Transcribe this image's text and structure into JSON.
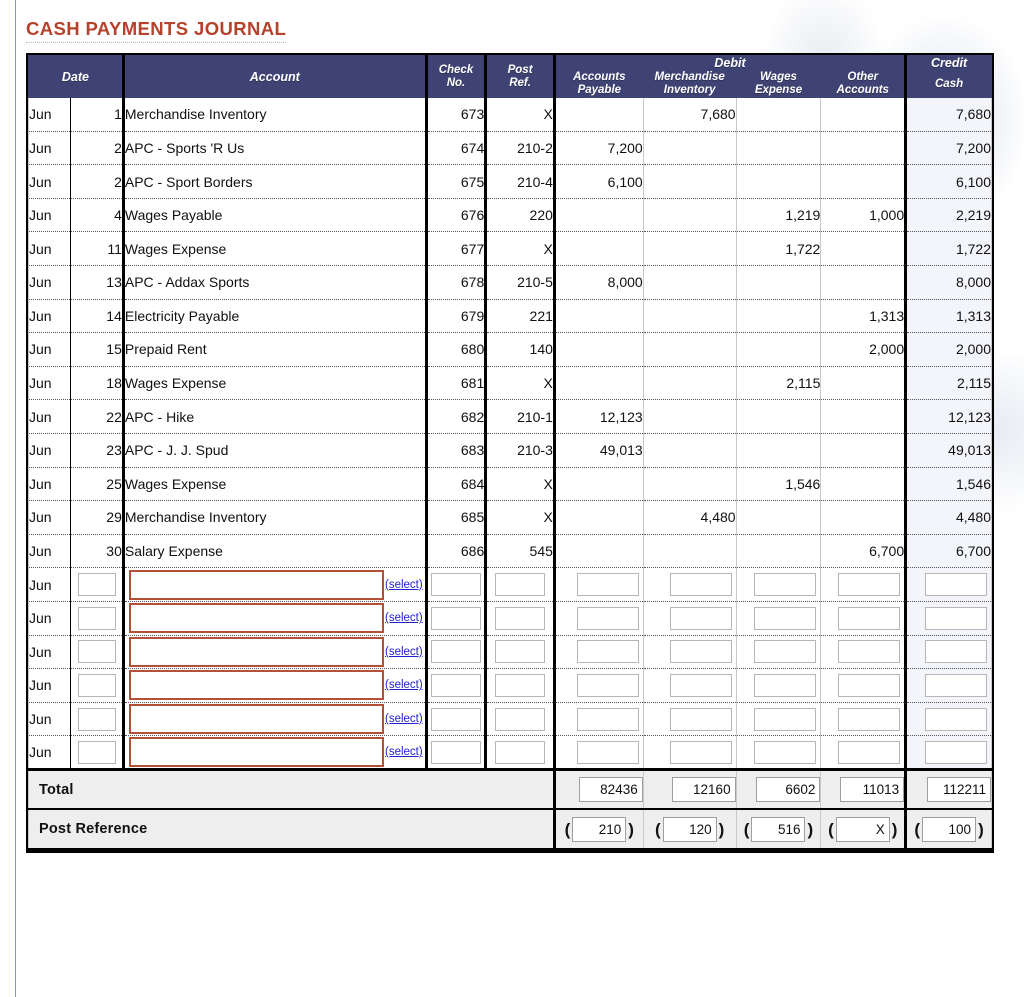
{
  "page": {
    "title": "CASH PAYMENTS JOURNAL",
    "title_color": "#b4422c",
    "header_bg": "#3e4373",
    "account_input_border": "#b4503a",
    "link_color": "#2222cc"
  },
  "table": {
    "headers": {
      "date": "Date",
      "account": "Account",
      "check_no": "Check No.",
      "check_no_l1": "Check",
      "check_no_l2": "No.",
      "post_ref": "Post Ref.",
      "post_ref_l1": "Post",
      "post_ref_l2": "Ref.",
      "debit_group": "Debit",
      "credit_group": "Credit",
      "accounts_payable_l1": "Accounts",
      "accounts_payable_l2": "Payable",
      "merchandise_inventory_l1": "Merchandise",
      "merchandise_inventory_l2": "Inventory",
      "wages_expense_l1": "Wages",
      "wages_expense_l2": "Expense",
      "other_accounts_l1": "Other",
      "other_accounts_l2": "Accounts",
      "cash": "Cash"
    },
    "rows": [
      {
        "month": "Jun",
        "day": "1",
        "account": "Merchandise Inventory",
        "check": "673",
        "ref": "X",
        "ap": "",
        "mi": "7,680",
        "we": "",
        "oa": "",
        "cash": "7,680"
      },
      {
        "month": "Jun",
        "day": "2",
        "account": "APC - Sports 'R Us",
        "check": "674",
        "ref": "210-2",
        "ap": "7,200",
        "mi": "",
        "we": "",
        "oa": "",
        "cash": "7,200"
      },
      {
        "month": "Jun",
        "day": "2",
        "account": "APC - Sport Borders",
        "check": "675",
        "ref": "210-4",
        "ap": "6,100",
        "mi": "",
        "we": "",
        "oa": "",
        "cash": "6,100"
      },
      {
        "month": "Jun",
        "day": "4",
        "account": "Wages Payable",
        "check": "676",
        "ref": "220",
        "ap": "",
        "mi": "",
        "we": "1,219",
        "oa": "1,000",
        "cash": "2,219"
      },
      {
        "month": "Jun",
        "day": "11",
        "account": "Wages Expense",
        "check": "677",
        "ref": "X",
        "ap": "",
        "mi": "",
        "we": "1,722",
        "oa": "",
        "cash": "1,722"
      },
      {
        "month": "Jun",
        "day": "13",
        "account": "APC - Addax Sports",
        "check": "678",
        "ref": "210-5",
        "ap": "8,000",
        "mi": "",
        "we": "",
        "oa": "",
        "cash": "8,000"
      },
      {
        "month": "Jun",
        "day": "14",
        "account": "Electricity Payable",
        "check": "679",
        "ref": "221",
        "ap": "",
        "mi": "",
        "we": "",
        "oa": "1,313",
        "cash": "1,313"
      },
      {
        "month": "Jun",
        "day": "15",
        "account": "Prepaid Rent",
        "check": "680",
        "ref": "140",
        "ap": "",
        "mi": "",
        "we": "",
        "oa": "2,000",
        "cash": "2,000"
      },
      {
        "month": "Jun",
        "day": "18",
        "account": "Wages Expense",
        "check": "681",
        "ref": "X",
        "ap": "",
        "mi": "",
        "we": "2,115",
        "oa": "",
        "cash": "2,115"
      },
      {
        "month": "Jun",
        "day": "22",
        "account": "APC - Hike",
        "check": "682",
        "ref": "210-1",
        "ap": "12,123",
        "mi": "",
        "we": "",
        "oa": "",
        "cash": "12,123"
      },
      {
        "month": "Jun",
        "day": "23",
        "account": "APC - J. J. Spud",
        "check": "683",
        "ref": "210-3",
        "ap": "49,013",
        "mi": "",
        "we": "",
        "oa": "",
        "cash": "49,013"
      },
      {
        "month": "Jun",
        "day": "25",
        "account": "Wages Expense",
        "check": "684",
        "ref": "X",
        "ap": "",
        "mi": "",
        "we": "1,546",
        "oa": "",
        "cash": "1,546"
      },
      {
        "month": "Jun",
        "day": "29",
        "account": "Merchandise Inventory",
        "check": "685",
        "ref": "X",
        "ap": "",
        "mi": "4,480",
        "we": "",
        "oa": "",
        "cash": "4,480"
      },
      {
        "month": "Jun",
        "day": "30",
        "account": "Salary Expense",
        "check": "686",
        "ref": "545",
        "ap": "",
        "mi": "",
        "we": "",
        "oa": "6,700",
        "cash": "6,700"
      }
    ],
    "entry_rows": [
      {
        "month": "Jun",
        "day": "",
        "account": "",
        "select_label": "(select)",
        "check": "",
        "ref": "",
        "ap": "",
        "mi": "",
        "we": "",
        "oa": "",
        "cash": ""
      },
      {
        "month": "Jun",
        "day": "",
        "account": "",
        "select_label": "(select)",
        "check": "",
        "ref": "",
        "ap": "",
        "mi": "",
        "we": "",
        "oa": "",
        "cash": ""
      },
      {
        "month": "Jun",
        "day": "",
        "account": "",
        "select_label": "(select)",
        "check": "",
        "ref": "",
        "ap": "",
        "mi": "",
        "we": "",
        "oa": "",
        "cash": ""
      },
      {
        "month": "Jun",
        "day": "",
        "account": "",
        "select_label": "(select)",
        "check": "",
        "ref": "",
        "ap": "",
        "mi": "",
        "we": "",
        "oa": "",
        "cash": ""
      },
      {
        "month": "Jun",
        "day": "",
        "account": "",
        "select_label": "(select)",
        "check": "",
        "ref": "",
        "ap": "",
        "mi": "",
        "we": "",
        "oa": "",
        "cash": ""
      },
      {
        "month": "Jun",
        "day": "",
        "account": "",
        "select_label": "(select)",
        "check": "",
        "ref": "",
        "ap": "",
        "mi": "",
        "we": "",
        "oa": "",
        "cash": ""
      }
    ],
    "total_row": {
      "label": "Total",
      "accounts_payable": "82436",
      "merchandise_inventory": "12160",
      "wages_expense": "6602",
      "other_accounts": "11013",
      "cash": "112211"
    },
    "post_reference_row": {
      "label": "Post Reference",
      "open_paren": "(",
      "close_paren": ")",
      "accounts_payable": "210",
      "merchandise_inventory": "120",
      "wages_expense": "516",
      "other_accounts": "X",
      "cash": "100"
    }
  }
}
